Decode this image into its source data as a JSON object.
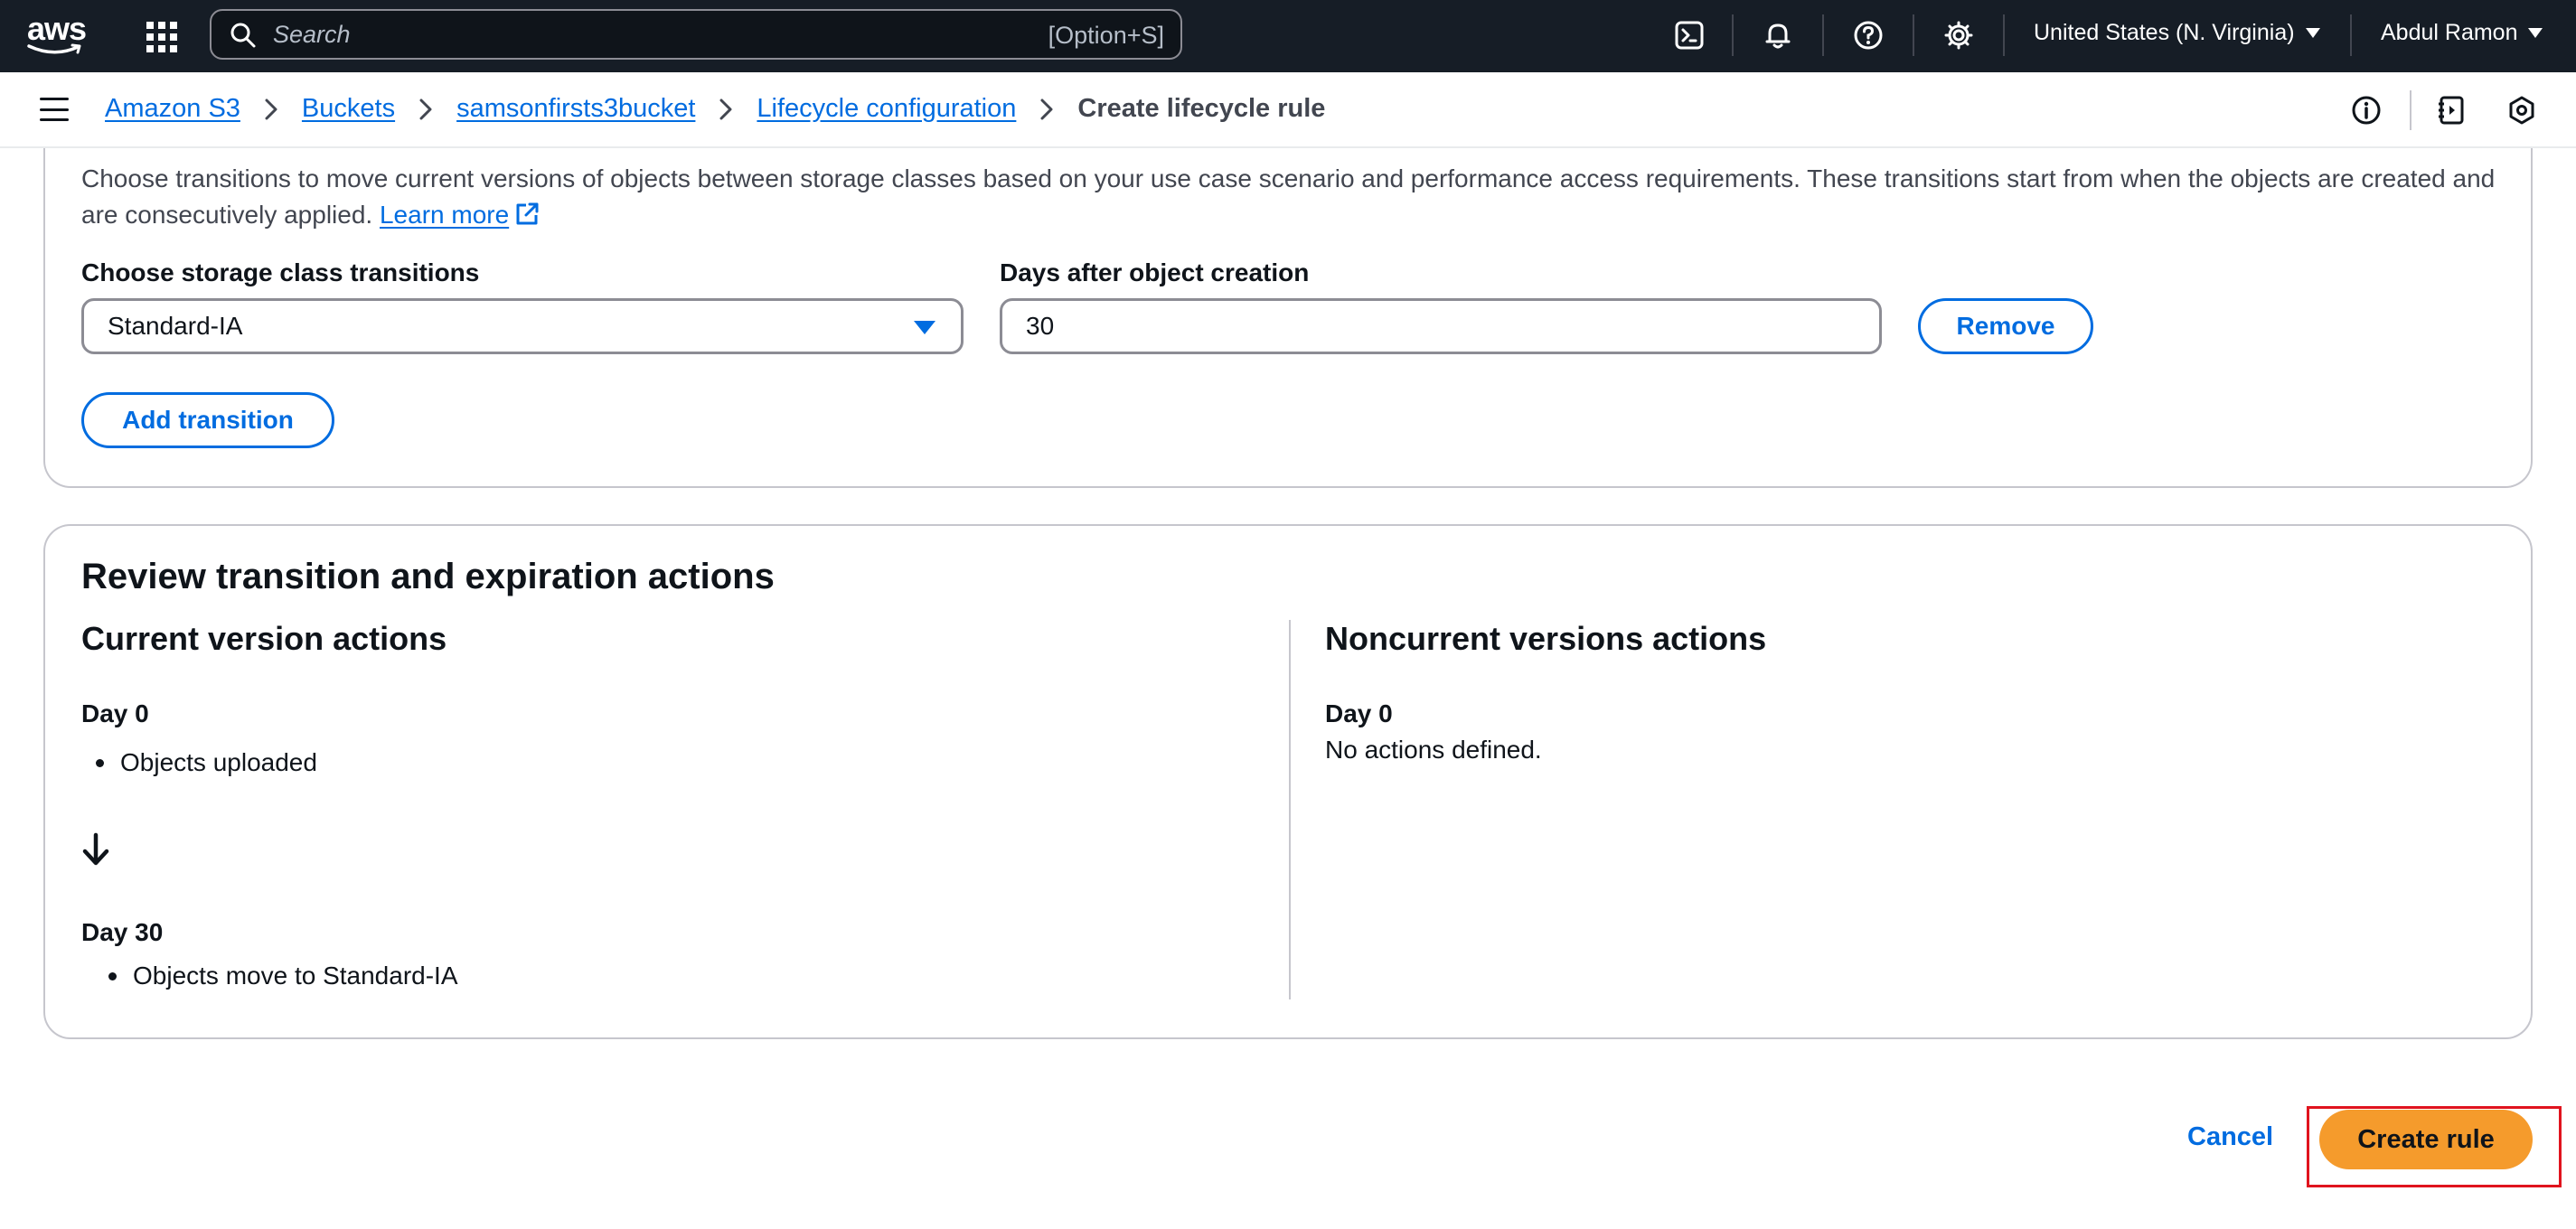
{
  "topnav": {
    "logo": "aws",
    "search_placeholder": "Search",
    "search_shortcut": "[Option+S]",
    "region": "United States (N. Virginia)",
    "user": "Abdul Ramon",
    "icons": [
      "cloudshell-icon",
      "bell-icon",
      "help-icon",
      "settings-icon"
    ]
  },
  "breadcrumb": {
    "items": [
      "Amazon S3",
      "Buckets",
      "samsonfirsts3bucket",
      "Lifecycle configuration"
    ],
    "current": "Create lifecycle rule"
  },
  "transitions": {
    "description": "Choose transitions to move current versions of objects between storage classes based on your use case scenario and performance access requirements. These transitions start from when the objects are created and are consecutively applied.",
    "learn_more": "Learn more",
    "storage_class_label": "Choose storage class transitions",
    "storage_class_value": "Standard-IA",
    "days_label": "Days after object creation",
    "days_value": "30",
    "remove_label": "Remove",
    "add_transition_label": "Add transition"
  },
  "review": {
    "title": "Review transition and expiration actions",
    "current": {
      "title": "Current version actions",
      "step1_day": "Day 0",
      "step1_item": "Objects uploaded",
      "step2_day": "Day 30",
      "step2_item": "Objects move to Standard-IA"
    },
    "noncurrent": {
      "title": "Noncurrent versions actions",
      "day": "Day 0",
      "text": "No actions defined."
    }
  },
  "footer": {
    "cancel_label": "Cancel",
    "create_label": "Create rule"
  },
  "colors": {
    "nav_bg": "#161d26",
    "link": "#006ce0",
    "primary_button": "#f59b2c",
    "highlight": "#e0141e"
  }
}
